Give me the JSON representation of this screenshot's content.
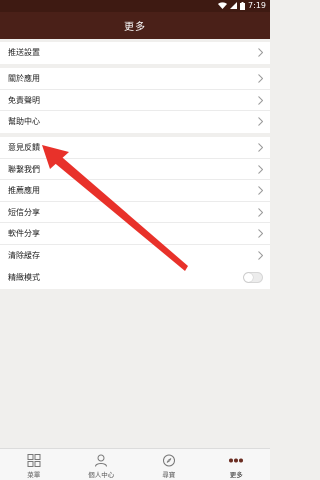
{
  "status": {
    "time": "7:19"
  },
  "title": "更多",
  "groups": [
    {
      "items": [
        {
          "label": "推送設置"
        }
      ]
    },
    {
      "items": [
        {
          "label": "關於應用"
        },
        {
          "label": "免責聲明"
        },
        {
          "label": "幫助中心"
        }
      ]
    },
    {
      "items": [
        {
          "label": "意見反饋"
        },
        {
          "label": "聯繫我們"
        },
        {
          "label": "推薦應用"
        },
        {
          "label": "短信分享"
        },
        {
          "label": "軟件分享"
        },
        {
          "label": "清除緩存"
        }
      ]
    },
    {
      "items": [
        {
          "label": "精緻模式",
          "toggle": false
        }
      ]
    }
  ],
  "tabs": [
    {
      "label": "菜單",
      "icon": "grid-icon",
      "active": false
    },
    {
      "label": "個人中心",
      "icon": "person-icon",
      "active": false
    },
    {
      "label": "尋寶",
      "icon": "compass-icon",
      "active": false
    },
    {
      "label": "更多",
      "icon": "more-dots-icon",
      "active": true
    }
  ],
  "colors": {
    "header": "#4a2018",
    "statusbar": "#3e1a12",
    "background": "#f0efed",
    "annotation_arrow": "#e8312a"
  }
}
